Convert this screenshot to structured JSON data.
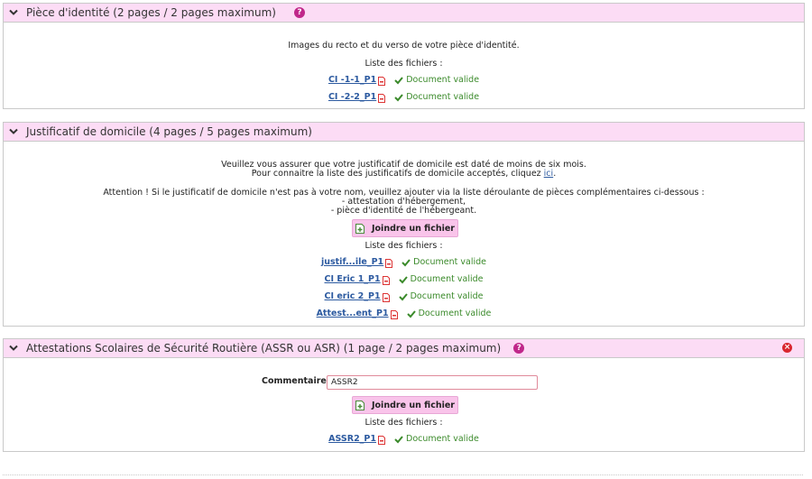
{
  "panels": [
    {
      "title": "Pièce d'identité (2 pages / 2 pages maximum)",
      "help": "?",
      "description": "Images du recto et du verso de votre pièce d'identité.",
      "files_label": "Liste des fichiers :",
      "files": [
        {
          "name": "CI -1-1_P1",
          "status": "Document valide"
        },
        {
          "name": "CI -2-2_P1",
          "status": "Document valide"
        }
      ]
    },
    {
      "title": "Justificatif de domicile (4 pages / 5 pages maximum)",
      "line1": "Veuillez vous assurer que votre justificatif de domicile est daté de moins de six mois.",
      "line2_pre": "Pour connaitre la liste des justificatifs de domicile acceptés, cliquez ",
      "line2_link": "ici",
      "line2_post": ".",
      "attention": "Attention ! Si le justificatif de domicile n'est pas à votre nom, veuillez ajouter via la liste déroulante de pièces complémentaires ci-dessous :",
      "bullet1": "- attestation d'hébergement,",
      "bullet2": "- pièce d'identité de l'hébergeant.",
      "join_label": "Joindre un fichier",
      "files_label": "Liste des fichiers :",
      "files": [
        {
          "name": "justif...ile_P1",
          "status": "Document valide"
        },
        {
          "name": "CI Eric 1_P1",
          "status": "Document valide"
        },
        {
          "name": "CI eric 2_P1",
          "status": "Document valide"
        },
        {
          "name": "Attest...ent_P1",
          "status": "Document valide"
        }
      ]
    },
    {
      "title": "Attestations Scolaires de Sécurité Routière (ASSR ou ASR) (1 page / 2 pages maximum)",
      "help": "?",
      "remove": "×",
      "comment_label": "Commentaire",
      "comment_value": "ASSR2",
      "join_label": "Joindre un fichier",
      "files_label": "Liste des fichiers :",
      "files": [
        {
          "name": "ASSR2_P1",
          "status": "Document valide"
        }
      ]
    }
  ],
  "colors": {
    "header_bg": "#fcdcf5",
    "button_bg": "#f9c4ea",
    "link": "#2c5aa0",
    "valid": "#3a8a2a",
    "help": "#c0278a",
    "remove": "#d9262f"
  },
  "icons": [
    "chevron-down-icon",
    "help-icon",
    "pdf-icon",
    "check-icon",
    "attach-file-icon",
    "remove-icon"
  ]
}
